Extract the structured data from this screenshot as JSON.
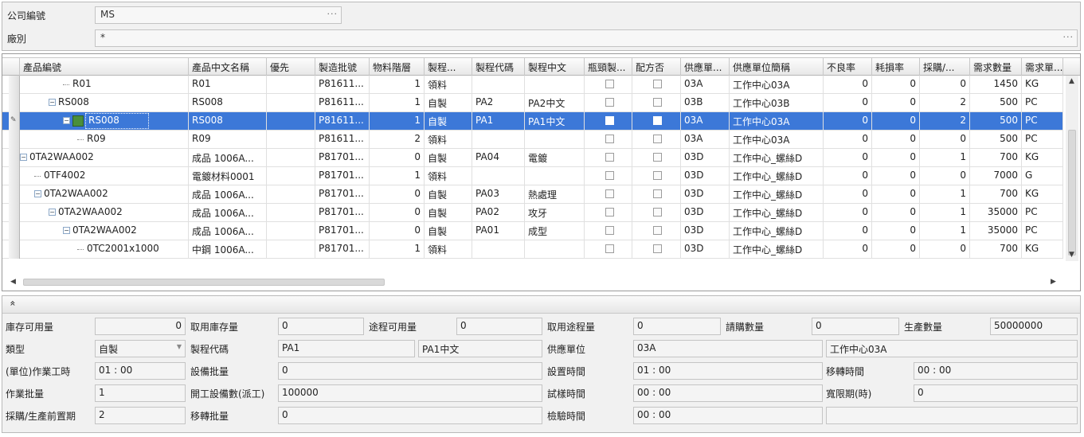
{
  "header": {
    "company_label": "公司編號",
    "company_value": "MS",
    "factory_label": "廠別",
    "factory_value": "*"
  },
  "grid": {
    "columns": [
      "產品編號",
      "產品中文名稱",
      "優先",
      "製造批號",
      "物料階層",
      "製程...",
      "製程代碼",
      "製程中文",
      "瓶頸製...",
      "配方否",
      "供應單...",
      "供應單位簡稱",
      "不良率",
      "耗損率",
      "採購/...",
      "需求數量",
      "需求單..."
    ],
    "rows": [
      {
        "id": "R01",
        "name": "R01",
        "pri": "",
        "batch": "P81611...",
        "level": "1",
        "proc": "領料",
        "pcode": "",
        "pname": "",
        "supp": "03A",
        "suppname": "工作中心03A",
        "defect": "0",
        "loss": "0",
        "purch": "0",
        "qty": "1450",
        "unit": "KG"
      },
      {
        "id": "RS008",
        "name": "RS008",
        "pri": "",
        "batch": "P81611...",
        "level": "1",
        "proc": "自製",
        "pcode": "PA2",
        "pname": "PA2中文",
        "supp": "03B",
        "suppname": "工作中心03B",
        "defect": "0",
        "loss": "0",
        "purch": "2",
        "qty": "500",
        "unit": "PC"
      },
      {
        "id": "RS008",
        "name": "RS008",
        "pri": "",
        "batch": "P81611...",
        "level": "1",
        "proc": "自製",
        "pcode": "PA1",
        "pname": "PA1中文",
        "supp": "03A",
        "suppname": "工作中心03A",
        "defect": "0",
        "loss": "0",
        "purch": "2",
        "qty": "500",
        "unit": "PC"
      },
      {
        "id": "R09",
        "name": "R09",
        "pri": "",
        "batch": "P81611...",
        "level": "2",
        "proc": "領料",
        "pcode": "",
        "pname": "",
        "supp": "03A",
        "suppname": "工作中心03A",
        "defect": "0",
        "loss": "0",
        "purch": "0",
        "qty": "500",
        "unit": "PC"
      },
      {
        "id": "0TA2WAA002",
        "name": "成品 1006A...",
        "pri": "",
        "batch": "P81701...",
        "level": "0",
        "proc": "自製",
        "pcode": "PA04",
        "pname": "電鍍",
        "supp": "03D",
        "suppname": "工作中心_螺絲D",
        "defect": "0",
        "loss": "0",
        "purch": "1",
        "qty": "700",
        "unit": "KG"
      },
      {
        "id": "0TF4002",
        "name": "電鍍材料0001",
        "pri": "",
        "batch": "P81701...",
        "level": "1",
        "proc": "領料",
        "pcode": "",
        "pname": "",
        "supp": "03D",
        "suppname": "工作中心_螺絲D",
        "defect": "0",
        "loss": "0",
        "purch": "0",
        "qty": "7000",
        "unit": "G"
      },
      {
        "id": "0TA2WAA002",
        "name": "成品 1006A...",
        "pri": "",
        "batch": "P81701...",
        "level": "0",
        "proc": "自製",
        "pcode": "PA03",
        "pname": "熱處理",
        "supp": "03D",
        "suppname": "工作中心_螺絲D",
        "defect": "0",
        "loss": "0",
        "purch": "1",
        "qty": "700",
        "unit": "KG"
      },
      {
        "id": "0TA2WAA002",
        "name": "成品 1006A...",
        "pri": "",
        "batch": "P81701...",
        "level": "0",
        "proc": "自製",
        "pcode": "PA02",
        "pname": "攻牙",
        "supp": "03D",
        "suppname": "工作中心_螺絲D",
        "defect": "0",
        "loss": "0",
        "purch": "1",
        "qty": "35000",
        "unit": "PC"
      },
      {
        "id": "0TA2WAA002",
        "name": "成品 1006A...",
        "pri": "",
        "batch": "P81701...",
        "level": "0",
        "proc": "自製",
        "pcode": "PA01",
        "pname": "成型",
        "supp": "03D",
        "suppname": "工作中心_螺絲D",
        "defect": "0",
        "loss": "0",
        "purch": "1",
        "qty": "35000",
        "unit": "PC"
      },
      {
        "id": "0TC2001x1000",
        "name": "中鋼 1006A...",
        "pri": "",
        "batch": "P81701...",
        "level": "1",
        "proc": "領料",
        "pcode": "",
        "pname": "",
        "supp": "03D",
        "suppname": "工作中心_螺絲D",
        "defect": "0",
        "loss": "0",
        "purch": "0",
        "qty": "700",
        "unit": "KG"
      }
    ]
  },
  "detail": {
    "collapse_glyph": "»",
    "stock_avail_label": "庫存可用量",
    "stock_avail": "0",
    "take_stock_label": "取用庫存量",
    "take_stock": "0",
    "transit_avail_label": "途程可用量",
    "transit_avail": "0",
    "take_transit_label": "取用途程量",
    "take_transit": "0",
    "purchase_qty_label": "請購數量",
    "purchase_qty": "0",
    "produce_qty_label": "生產數量",
    "produce_qty": "50000000",
    "type_label": "類型",
    "type_value": "自製",
    "proc_code_label": "製程代碼",
    "proc_code": "PA1",
    "proc_name": "PA1中文",
    "supplier_label": "供應單位",
    "supplier_code": "03A",
    "supplier_name": "工作中心03A",
    "unit_work_label": "(單位)作業工時",
    "unit_work": "01 : 00",
    "equip_batch_label": "設備批量",
    "equip_batch": "0",
    "setup_time_label": "設置時間",
    "setup_time": "01 : 00",
    "move_time_label": "移轉時間",
    "move_time": "00 : 00",
    "work_batch_label": "作業批量",
    "work_batch": "1",
    "open_equip_label": "開工設備數(派工)",
    "open_equip": "100000",
    "trial_time_label": "試樣時間",
    "trial_time": "00 : 00",
    "grace_label": "寬限期(時)",
    "grace": "0",
    "lead_label": "採購/生產前置期",
    "lead": "2",
    "move_batch_label": "移轉批量",
    "move_batch": "0",
    "inspect_label": "檢驗時間",
    "inspect": "00 : 00"
  }
}
